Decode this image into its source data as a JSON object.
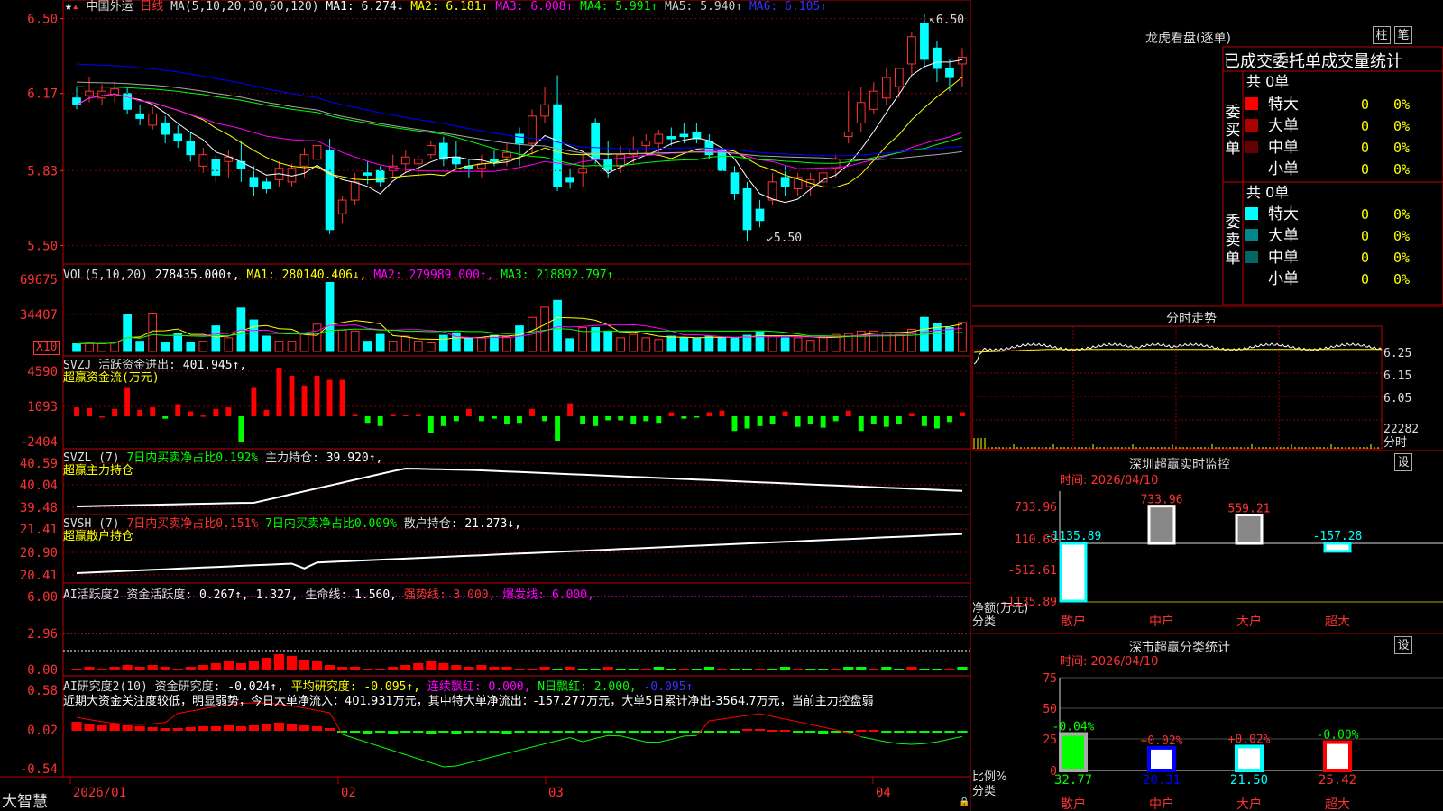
{
  "app": {
    "brand": "大智慧",
    "lock_icon": "lock-icon",
    "star_icon": "star-icon"
  },
  "colors": {
    "up": "#ff3232",
    "down": "#00ffff",
    "bg": "#000000",
    "grid": "#8b0000",
    "ma1": "#ffffff",
    "ma2": "#ffff00",
    "ma3": "#ff00ff",
    "ma4": "#00ff00",
    "ma5": "#aaaaaa",
    "ma6": "#0000ff"
  },
  "main": {
    "stock_name": "中国外运",
    "period": "日线",
    "ma_label": "MA(5,10,20,30,60,120)",
    "ma": [
      {
        "label": "MA1:",
        "value": "6.274↓",
        "color": "#ffffff"
      },
      {
        "label": "MA2:",
        "value": "6.181↑",
        "color": "#ffff00"
      },
      {
        "label": "MA3:",
        "value": "6.008↑",
        "color": "#ff00ff"
      },
      {
        "label": "MA4:",
        "value": "5.991↑",
        "color": "#00ff00"
      },
      {
        "label": "MA5:",
        "value": "5.940↑",
        "color": "#cccccc"
      },
      {
        "label": "MA6:",
        "value": "6.105↑",
        "color": "#3333ff"
      }
    ],
    "y_ticks": [
      "6.50",
      "6.17",
      "5.83",
      "5.50"
    ],
    "hi_marker": "6.50",
    "lo_marker": "5.50"
  },
  "vol": {
    "title": "VOL(5,10,20)",
    "value": "278435.000↑,",
    "ma1": "MA1: 280140.406↓,",
    "ma2": "MA2: 279989.000↑,",
    "ma3": "MA3: 218892.797↑",
    "y_ticks": [
      "69675",
      "34407"
    ],
    "unit": "X10"
  },
  "svzj": {
    "title": "SVZJ",
    "label": "活跃资金进出:",
    "value": "401.945↑,",
    "subtitle": "超赢资金流(万元)",
    "y_ticks": [
      "4590",
      "1093",
      "-2404"
    ]
  },
  "svzl": {
    "title": "SVZL (7)",
    "label1": "7日内买卖净占比0.192%",
    "label2": "主力持仓:",
    "value": "39.920↑,",
    "subtitle": "超赢主力持仓",
    "y_ticks": [
      "40.59",
      "40.04",
      "39.48"
    ]
  },
  "svsh": {
    "title": "SVSH (7)",
    "label1": "7日内买卖净占比0.151%",
    "label2": "7日内买卖净占比0.009%",
    "label3": "散户持仓:",
    "value": "21.273↓,",
    "subtitle": "超赢散户持仓",
    "y_ticks": [
      "21.41",
      "20.90",
      "20.41"
    ]
  },
  "ai1": {
    "title": "AI活跃度2",
    "label": "资金活跃度:",
    "v1": "0.267↑,",
    "v2": "1.327,",
    "life_label": "生命线:",
    "life": "1.560,",
    "strong": "强势线: 3.000,",
    "burst": "爆发线: 6.000,",
    "y_ticks": [
      "6.00",
      "2.96",
      "0.00"
    ]
  },
  "ai2": {
    "title": "AI研究度2(10)",
    "label": "资金研究度:",
    "value": "-0.024↑,",
    "avg": "平均研究度: -0.095↑,",
    "red": "连续飘红: 0.000,",
    "nred": "N日飘红: 2.000,",
    "last": "-0.095↑",
    "comment": "近期大资金关注度较低，明显弱势，今日大单净流入：401.931万元，其中特大单净流出：-157.277万元，大单5日累计净出-3564.7万元，当前主力控盘弱",
    "y_ticks": [
      "0.58",
      "0.02",
      "-0.54"
    ]
  },
  "x_ticks": [
    "2026/01",
    "02",
    "03",
    "04"
  ],
  "right": {
    "lhb_title": "龙虎看盘(逐单)",
    "btn_bar": "柱",
    "btn_pen": "笔",
    "tabs": [
      "已成交",
      "委托单",
      "成交量统计"
    ],
    "buy_side": "委买单",
    "sell_side": "委卖单",
    "buy_total": "共 0单",
    "sell_total": "共 0单",
    "buy_rows": [
      {
        "name": "特大",
        "n": "0",
        "pct": "0%",
        "color": "#ff0000"
      },
      {
        "name": "大单",
        "n": "0",
        "pct": "0%",
        "color": "#aa0000"
      },
      {
        "name": "中单",
        "n": "0",
        "pct": "0%",
        "color": "#660000"
      },
      {
        "name": "小单",
        "n": "0",
        "pct": "0%",
        "color": "#000000"
      }
    ],
    "sell_rows": [
      {
        "name": "特大",
        "n": "0",
        "pct": "0%",
        "color": "#00ffff"
      },
      {
        "name": "大单",
        "n": "0",
        "pct": "0%",
        "color": "#008888"
      },
      {
        "name": "中单",
        "n": "0",
        "pct": "0%",
        "color": "#006666"
      },
      {
        "name": "小单",
        "n": "0",
        "pct": "0%",
        "color": "#000000"
      }
    ],
    "intraday_title": "分时走势",
    "intraday_y": [
      "6.25",
      "6.15",
      "6.05"
    ],
    "intraday_vol": "22282",
    "intraday_unit": "分时",
    "sz_title": "深圳超赢实时监控",
    "sz_btn": "设",
    "sz_time": "时间: 2026/04/10",
    "sz_y": [
      "733.96",
      "110.68",
      "-512.61",
      "-1135.89"
    ],
    "sz_unit1": "净额(万元)",
    "sz_unit2": "分类",
    "sz_cats": [
      "散户",
      "中户",
      "大户",
      "超大"
    ],
    "sz_vals": [
      -1135.89,
      733.96,
      559.21,
      -157.28
    ],
    "sz_labels": [
      "-1135.89",
      "733.96",
      "559.21",
      "-157.28"
    ],
    "cls_title": "深市超赢分类统计",
    "cls_btn": "设",
    "cls_time": "时间: 2026/04/10",
    "cls_y": [
      "75",
      "50",
      "25",
      "0"
    ],
    "cls_unit1": "比例%",
    "cls_unit2": "分类",
    "cls_cats": [
      "散户",
      "中户",
      "大户",
      "超大"
    ],
    "cls_top": [
      "-0.04%",
      "+0.02%",
      "+0.02%",
      "-0.00%"
    ],
    "cls_bottom": [
      "32.77",
      "20.31",
      "21.50",
      "25.42"
    ],
    "cls_vals": [
      32.77,
      20.31,
      21.5,
      25.42
    ]
  },
  "chart_data": {
    "type": "candlestick",
    "x_dates_start": "2026/01",
    "ylim": [
      5.45,
      6.55
    ],
    "candles": [
      [
        6.15,
        6.2,
        6.1,
        6.12
      ],
      [
        6.16,
        6.24,
        6.13,
        6.18
      ],
      [
        6.15,
        6.21,
        6.12,
        6.18
      ],
      [
        6.16,
        6.22,
        6.13,
        6.19
      ],
      [
        6.17,
        6.2,
        6.08,
        6.1
      ],
      [
        6.08,
        6.12,
        6.03,
        6.06
      ],
      [
        6.03,
        6.11,
        6.01,
        6.08
      ],
      [
        6.04,
        6.07,
        5.95,
        5.99
      ],
      [
        5.99,
        6.03,
        5.93,
        5.96
      ],
      [
        5.96,
        6.0,
        5.87,
        5.9
      ],
      [
        5.85,
        5.93,
        5.82,
        5.9
      ],
      [
        5.88,
        5.9,
        5.78,
        5.81
      ],
      [
        5.87,
        5.92,
        5.8,
        5.89
      ],
      [
        5.87,
        5.96,
        5.78,
        5.84
      ],
      [
        5.8,
        5.85,
        5.72,
        5.76
      ],
      [
        5.78,
        5.8,
        5.73,
        5.75
      ],
      [
        5.79,
        5.87,
        5.76,
        5.84
      ],
      [
        5.78,
        5.86,
        5.76,
        5.84
      ],
      [
        5.85,
        5.93,
        5.8,
        5.9
      ],
      [
        5.88,
        6.0,
        5.86,
        5.94
      ],
      [
        5.92,
        5.97,
        5.55,
        5.57
      ],
      [
        5.64,
        5.72,
        5.6,
        5.7
      ],
      [
        5.7,
        5.82,
        5.68,
        5.78
      ],
      [
        5.82,
        5.87,
        5.77,
        5.81
      ],
      [
        5.83,
        5.85,
        5.76,
        5.78
      ],
      [
        5.83,
        5.9,
        5.8,
        5.85
      ],
      [
        5.86,
        5.92,
        5.82,
        5.89
      ],
      [
        5.86,
        5.9,
        5.8,
        5.88
      ],
      [
        5.9,
        5.96,
        5.88,
        5.94
      ],
      [
        5.95,
        5.98,
        5.85,
        5.88
      ],
      [
        5.89,
        5.96,
        5.84,
        5.86
      ],
      [
        5.85,
        5.88,
        5.8,
        5.84
      ],
      [
        5.84,
        5.9,
        5.8,
        5.86
      ],
      [
        5.88,
        5.92,
        5.85,
        5.87
      ],
      [
        5.89,
        5.95,
        5.85,
        5.91
      ],
      [
        5.99,
        6.02,
        5.85,
        5.95
      ],
      [
        5.95,
        6.1,
        5.9,
        6.07
      ],
      [
        6.07,
        6.2,
        6.04,
        6.12
      ],
      [
        6.12,
        6.25,
        5.74,
        5.76
      ],
      [
        5.8,
        5.84,
        5.75,
        5.78
      ],
      [
        5.82,
        5.9,
        5.76,
        5.84
      ],
      [
        6.04,
        6.06,
        5.86,
        5.88
      ],
      [
        5.88,
        5.96,
        5.8,
        5.83
      ],
      [
        5.85,
        5.94,
        5.82,
        5.9
      ],
      [
        5.9,
        5.98,
        5.86,
        5.92
      ],
      [
        5.94,
        5.99,
        5.9,
        5.96
      ],
      [
        5.95,
        6.01,
        5.91,
        5.99
      ],
      [
        5.98,
        6.02,
        5.94,
        5.97
      ],
      [
        5.99,
        6.04,
        5.95,
        5.98
      ],
      [
        6.0,
        6.04,
        5.95,
        5.97
      ],
      [
        5.96,
        5.99,
        5.88,
        5.9
      ],
      [
        5.92,
        5.94,
        5.8,
        5.83
      ],
      [
        5.82,
        5.85,
        5.7,
        5.73
      ],
      [
        5.75,
        5.78,
        5.52,
        5.57
      ],
      [
        5.66,
        5.7,
        5.58,
        5.61
      ],
      [
        5.7,
        5.82,
        5.68,
        5.78
      ],
      [
        5.8,
        5.85,
        5.72,
        5.76
      ],
      [
        5.75,
        5.82,
        5.72,
        5.8
      ],
      [
        5.76,
        5.82,
        5.72,
        5.79
      ],
      [
        5.78,
        5.84,
        5.75,
        5.82
      ],
      [
        5.84,
        5.9,
        5.8,
        5.88
      ],
      [
        5.98,
        6.18,
        5.95,
        6.0
      ],
      [
        6.04,
        6.2,
        6.0,
        6.13
      ],
      [
        6.1,
        6.22,
        6.08,
        6.18
      ],
      [
        6.15,
        6.28,
        6.12,
        6.24
      ],
      [
        6.2,
        6.28,
        6.15,
        6.28
      ],
      [
        6.3,
        6.44,
        6.25,
        6.42
      ],
      [
        6.48,
        6.52,
        6.28,
        6.32
      ],
      [
        6.37,
        6.4,
        6.22,
        6.28
      ],
      [
        6.28,
        6.32,
        6.18,
        6.24
      ],
      [
        6.3,
        6.37,
        6.2,
        6.33
      ]
    ],
    "volume": [
      4.5,
      5,
      4.5,
      5.5,
      21.5,
      6,
      22.5,
      5.5,
      10.5,
      5.5,
      6,
      15,
      8,
      25.5,
      18.5,
      9,
      6,
      6,
      10,
      16,
      40.5,
      12.5,
      12,
      6,
      10,
      6,
      9,
      6,
      5,
      9.5,
      11,
      8,
      8,
      9.5,
      8.5,
      15,
      20,
      26,
      30,
      7.5,
      14,
      14,
      12,
      8,
      10,
      8,
      7,
      9,
      8,
      8,
      9,
      8,
      8,
      9.5,
      11.5,
      9,
      8,
      8,
      6.5,
      9,
      10,
      10.5,
      12,
      12,
      11,
      10,
      13,
      20,
      16.5,
      14,
      17
    ],
    "svzj": [
      1.1,
      1.0,
      0,
      0.9,
      3.5,
      0.8,
      1.1,
      -0.3,
      1.5,
      0.6,
      0.1,
      0.9,
      1.1,
      -3.2,
      3.5,
      0.8,
      6.0,
      5.0,
      3.8,
      5.0,
      4.5,
      4.5,
      0.3,
      -0.8,
      -1.2,
      0.3,
      0.2,
      0.3,
      -2.0,
      -1.2,
      -0.6,
      0.9,
      -0.6,
      -0.3,
      -1.0,
      -0.8,
      0.9,
      -0.6,
      -3.0,
      1.6,
      -1.0,
      -1.2,
      -0.5,
      -0.5,
      -1.0,
      -0.6,
      -0.8,
      0.5,
      -0.3,
      -0.1,
      0.5,
      0.7,
      -1.8,
      -1.5,
      -1.2,
      -1.0,
      0.6,
      -1.3,
      -1.0,
      -1.4,
      -0.6,
      0.7,
      -1.8,
      -1.0,
      -1.3,
      -1.0,
      0.4,
      -1.2,
      -1.5,
      -0.7,
      0.5
    ]
  }
}
